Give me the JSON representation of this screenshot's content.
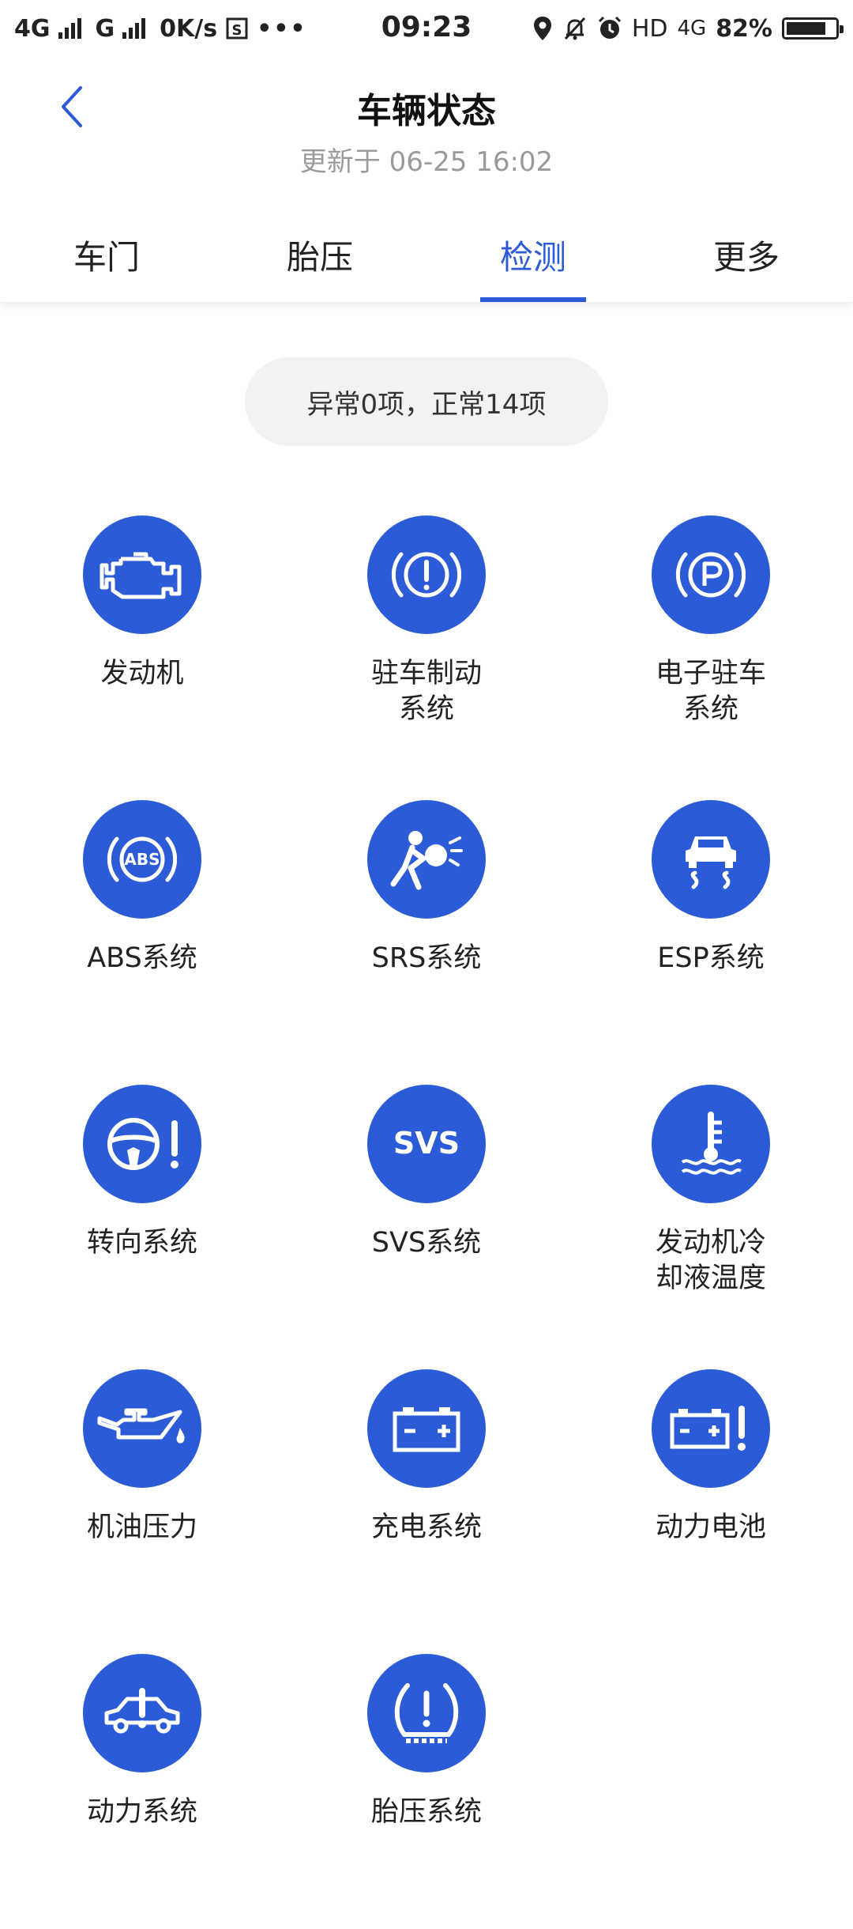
{
  "status_bar": {
    "net1": "4G",
    "net2": "G",
    "speed": "0K/s",
    "time": "09:23",
    "hd": "HD",
    "net3": "4G",
    "battery_percent": "82%",
    "battery_level": 0.82
  },
  "header": {
    "title": "车辆状态",
    "subtitle": "更新于 06-25 16:02"
  },
  "tabs": [
    {
      "label": "车门",
      "active": false
    },
    {
      "label": "胎压",
      "active": false
    },
    {
      "label": "检测",
      "active": true
    },
    {
      "label": "更多",
      "active": false
    }
  ],
  "summary": "异常0项，正常14项",
  "accent_color": "#2b5bd7",
  "items": [
    {
      "icon": "engine-icon",
      "label": "发动机"
    },
    {
      "icon": "parking-brake-icon",
      "label": "驻车制动系统"
    },
    {
      "icon": "electronic-parking-icon",
      "label": "电子驻车系统"
    },
    {
      "icon": "abs-icon",
      "label": "ABS系统"
    },
    {
      "icon": "airbag-icon",
      "label": "SRS系统"
    },
    {
      "icon": "esp-icon",
      "label": "ESP系统"
    },
    {
      "icon": "steering-icon",
      "label": "转向系统"
    },
    {
      "icon": "svs-icon",
      "label": "SVS系统"
    },
    {
      "icon": "coolant-temperature-icon",
      "label": "发动机冷却液温度"
    },
    {
      "icon": "oil-pressure-icon",
      "label": "机油压力"
    },
    {
      "icon": "battery-icon",
      "label": "充电系统"
    },
    {
      "icon": "power-battery-icon",
      "label": "动力电池"
    },
    {
      "icon": "powertrain-icon",
      "label": "动力系统"
    },
    {
      "icon": "tire-pressure-icon",
      "label": "胎压系统"
    }
  ]
}
